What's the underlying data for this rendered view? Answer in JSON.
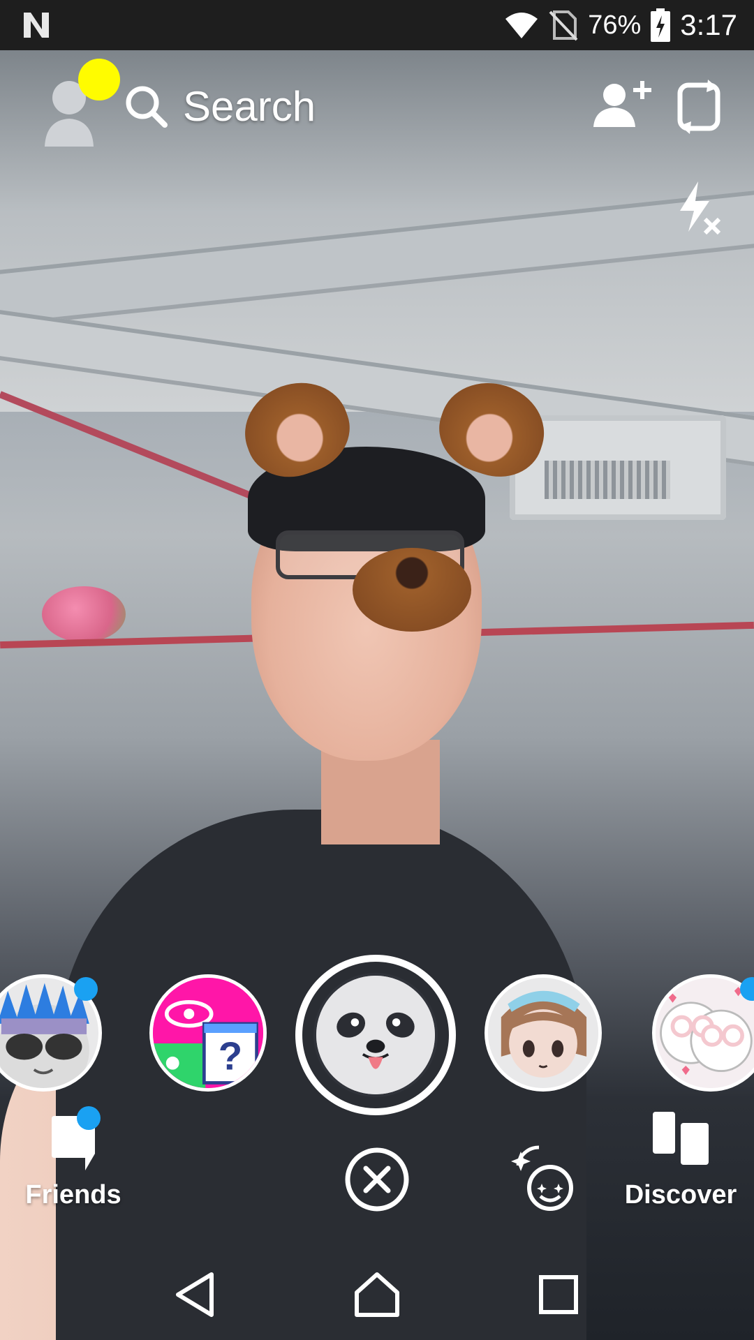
{
  "status_bar": {
    "battery": "76%",
    "time": "3:17",
    "icons": [
      "n-logo-icon",
      "wifi-icon",
      "no-sim-icon",
      "battery-charging-icon"
    ]
  },
  "top_bar": {
    "search_label": "Search",
    "icons": [
      "profile-avatar-icon",
      "search-icon",
      "add-friend-icon",
      "flip-camera-icon",
      "flash-off-icon"
    ]
  },
  "lenses": {
    "items": [
      "sunglasses-spiky-lens",
      "eye-question-lens",
      "dog-face-lens",
      "anime-girl-lens",
      "hearts-eyes-lens"
    ],
    "selected": "dog-face-lens"
  },
  "bottom_bar": {
    "friends_label": "Friends",
    "discover_label": "Discover",
    "icons": [
      "chat-icon",
      "close-icon",
      "lens-explorer-icon",
      "discover-icon"
    ]
  },
  "nav_bar": {
    "icons": [
      "back-icon",
      "home-icon",
      "recents-icon"
    ]
  },
  "colors": {
    "accent_yellow": "#fffc00",
    "notification_blue": "#1aa1f2"
  }
}
